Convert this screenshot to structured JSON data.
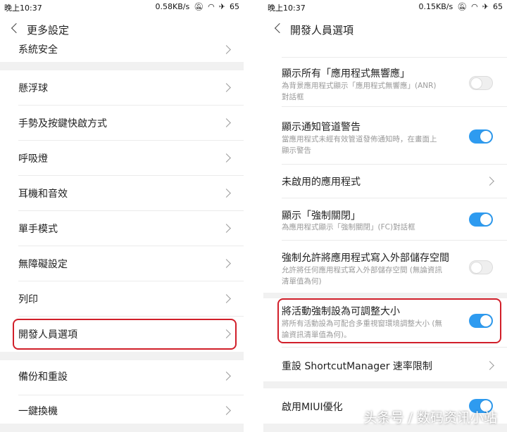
{
  "left": {
    "status": {
      "time": "晚上10:37",
      "speed": "0.58KB/s",
      "battery": "65"
    },
    "title": "更多設定",
    "items": [
      {
        "label": "系統安全"
      },
      {
        "label": "懸浮球"
      },
      {
        "label": "手勢及按鍵快啟方式"
      },
      {
        "label": "呼吸燈"
      },
      {
        "label": "耳機和音效"
      },
      {
        "label": "單手模式"
      },
      {
        "label": "無障礙設定"
      },
      {
        "label": "列印"
      },
      {
        "label": "開發人員選項"
      },
      {
        "label": "備份和重設"
      },
      {
        "label": "一鍵換機"
      }
    ]
  },
  "right": {
    "status": {
      "time": "晚上10:37",
      "speed": "0.15KB/s",
      "battery": "65"
    },
    "title": "開發人員選項",
    "items": [
      {
        "label": "顯示所有「應用程式無響應」",
        "sub": "為背景應用程式顯示「應用程式無響應」(ANR)對話框",
        "toggle": "off"
      },
      {
        "label": "顯示通知管道警告",
        "sub": "當應用程式未經有效管道發佈通知時，在畫面上顯示警告",
        "toggle": "on"
      },
      {
        "label": "未啟用的應用程式",
        "type": "chevron"
      },
      {
        "label": "顯示「強制關閉」",
        "sub": "為應用程式顯示「強制關閉」(FC)對話框",
        "toggle": "on"
      },
      {
        "label": "強制允許將應用程式寫入外部儲存空間",
        "sub": "允許將任何應用程式寫入外部儲存空間 (無論資訊清單值為何)",
        "toggle": "off"
      },
      {
        "label": "將活動強制設為可調整大小",
        "sub": "將所有活動設為可配合多重視窗環境調整大小 (無論資訊清單值為何)。",
        "toggle": "on"
      },
      {
        "label": "重設 ShortcutManager 速率限制",
        "type": "chevron"
      },
      {
        "label": "啟用MIUI優化",
        "toggle": "on"
      }
    ]
  },
  "watermark": "头条号 / 数码资讯小站",
  "colors": {
    "accent": "#2e9bf0",
    "highlight": "#d11f2a"
  },
  "icons": [
    "back-arrow-icon",
    "chevron-right-icon",
    "wifi-icon",
    "mute-icon",
    "airplane-icon"
  ]
}
